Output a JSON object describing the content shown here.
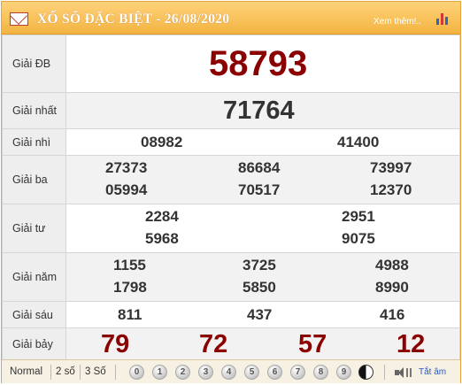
{
  "header": {
    "title": "XỔ SỐ ĐẶC BIỆT -",
    "date": "26/08/2020",
    "more_link": "Xem thêm!..",
    "icons": {
      "envelope": "envelope-icon",
      "chart": "bar-chart-icon"
    }
  },
  "prizes": [
    {
      "label": "Giải ĐB",
      "numbers": [
        "58793"
      ]
    },
    {
      "label": "Giải nhất",
      "numbers": [
        "71764"
      ]
    },
    {
      "label": "Giải nhì",
      "numbers": [
        "08982",
        "41400"
      ]
    },
    {
      "label": "Giải ba",
      "numbers": [
        "27373",
        "86684",
        "73997",
        "05994",
        "70517",
        "12370"
      ]
    },
    {
      "label": "Giải tư",
      "numbers": [
        "2284",
        "2951",
        "5968",
        "9075"
      ]
    },
    {
      "label": "Giải năm",
      "numbers": [
        "1155",
        "3725",
        "4988",
        "1798",
        "5850",
        "8990"
      ]
    },
    {
      "label": "Giải sáu",
      "numbers": [
        "811",
        "437",
        "416"
      ]
    },
    {
      "label": "Giải bảy",
      "numbers": [
        "79",
        "72",
        "57",
        "12"
      ]
    }
  ],
  "footer": {
    "modes": [
      "Normal",
      "2 số",
      "3 Số"
    ],
    "digits": [
      "0",
      "1",
      "2",
      "3",
      "4",
      "5",
      "6",
      "7",
      "8",
      "9"
    ],
    "mute_label": "Tắt âm"
  },
  "colors": {
    "header": "#f3b441",
    "special": "#8b0000",
    "text": "#333333"
  }
}
